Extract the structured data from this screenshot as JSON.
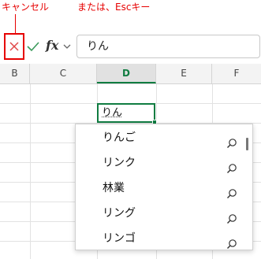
{
  "annotations": {
    "cancel": "キャンセル",
    "esc": "または、Escキー"
  },
  "formula_bar": {
    "fx_label": "fx",
    "content": "りん"
  },
  "columns": [
    "B",
    "C",
    "D",
    "E",
    "F"
  ],
  "active_column": "D",
  "active_cell": {
    "value": "りん"
  },
  "suggestions": [
    "りんご",
    "リンク",
    "林業",
    "リング",
    "リンゴ"
  ],
  "colors": {
    "accent_green": "#107c41",
    "annotation_red": "#e60000"
  }
}
